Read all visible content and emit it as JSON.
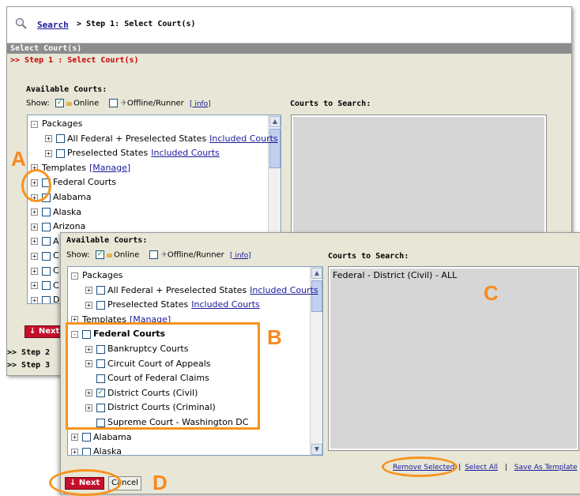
{
  "header": {
    "search_link": "Search",
    "breadcrumb_rest": "> Step 1: Select Court(s)",
    "section_bar": "Select Court(s)",
    "step_title": ">> Step 1 : Select Court(s)"
  },
  "selector": {
    "available_title": "Available Courts:",
    "show_label": "Show:",
    "online_label": "Online",
    "offline_label": "Offline/Runner",
    "info_link": "[ info]",
    "courts_to_search_title": "Courts to Search:"
  },
  "tree_back": [
    {
      "label": "Packages",
      "pm": "-",
      "cb": false,
      "indent": 0
    },
    {
      "label": "All Federal + Preselected States",
      "link": "Included Courts",
      "pm": "+",
      "cb": true,
      "indent": 1
    },
    {
      "label": "Preselected States",
      "link": "Included Courts",
      "pm": "+",
      "cb": true,
      "indent": 1
    },
    {
      "label": "Templates",
      "link": "[Manage]",
      "pm": "+",
      "cb": false,
      "indent": 0
    },
    {
      "label": "Federal Courts",
      "pm": "+",
      "cb": true,
      "indent": 0
    },
    {
      "label": "Alabama",
      "pm": "+",
      "cb": true,
      "indent": 0
    },
    {
      "label": "Alaska",
      "pm": "+",
      "cb": true,
      "indent": 0
    },
    {
      "label": "Arizona",
      "pm": "+",
      "cb": true,
      "indent": 0
    },
    {
      "label": "A",
      "pm": "+",
      "cb": true,
      "indent": 0
    },
    {
      "label": "C",
      "pm": "+",
      "cb": true,
      "indent": 0
    },
    {
      "label": "C",
      "pm": "+",
      "cb": true,
      "indent": 0
    },
    {
      "label": "C",
      "pm": "+",
      "cb": true,
      "indent": 0
    },
    {
      "label": "D",
      "pm": "+",
      "cb": true,
      "indent": 0
    }
  ],
  "tree_front": [
    {
      "label": "Packages",
      "pm": "-",
      "cb": false,
      "indent": 0
    },
    {
      "label": "All Federal + Preselected States",
      "link": "Included Courts",
      "pm": "+",
      "cb": true,
      "indent": 1
    },
    {
      "label": "Preselected States",
      "link": "Included Courts",
      "pm": "+",
      "cb": true,
      "indent": 1
    },
    {
      "label": "Templates",
      "link": "[Manage]",
      "pm": "+",
      "cb": false,
      "indent": 0
    },
    {
      "label": "Federal Courts",
      "pm": "-",
      "cb": true,
      "indent": 0,
      "bold": true
    },
    {
      "label": "Bankruptcy Courts",
      "pm": "+",
      "cb": true,
      "indent": 1
    },
    {
      "label": "Circuit Court of Appeals",
      "pm": "+",
      "cb": true,
      "indent": 1
    },
    {
      "label": "Court of Federal Claims",
      "pm": "",
      "cb": true,
      "indent": 1
    },
    {
      "label": "District Courts (Civil)",
      "pm": "+",
      "cb": true,
      "checked": true,
      "indent": 1
    },
    {
      "label": "District Courts (Criminal)",
      "pm": "+",
      "cb": true,
      "indent": 1
    },
    {
      "label": "Supreme Court - Washington DC",
      "pm": "",
      "cb": true,
      "indent": 1
    },
    {
      "label": "Alabama",
      "pm": "+",
      "cb": true,
      "indent": 0
    },
    {
      "label": "Alaska",
      "pm": "+",
      "cb": true,
      "indent": 0
    }
  ],
  "courts_to_search_items": [
    "Federal - District (Civil) - ALL"
  ],
  "actions": {
    "remove_selected": "Remove Selected",
    "select_all": "Select All",
    "save_as_template": "Save As Template",
    "separator": "|",
    "next_label": "↓ Next",
    "cancel_label": "Cancel",
    "next_partial": "↓ Next"
  },
  "steps": {
    "step2": ">> Step 2",
    "step3": ">> Step 3"
  },
  "annotations": {
    "a": "A",
    "b": "B",
    "c": "C",
    "d": "D"
  },
  "colors": {
    "panel_bg": "#e8e7d7",
    "step_red": "#cc0000",
    "next_red": "#c4102b",
    "annotation_orange": "#f7931e",
    "link_blue": "#1a1a9c",
    "section_bar": "#8c8c8c"
  }
}
